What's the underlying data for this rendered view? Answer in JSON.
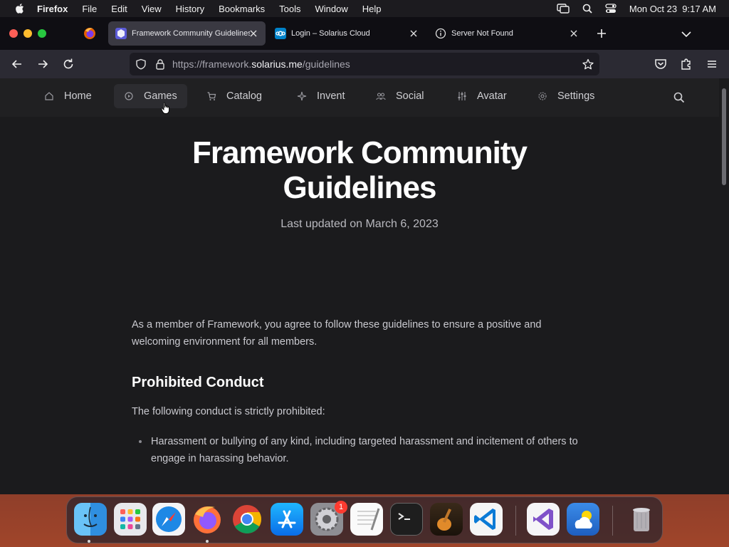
{
  "menubar": {
    "app_name": "Firefox",
    "items": [
      "File",
      "Edit",
      "View",
      "History",
      "Bookmarks",
      "Tools",
      "Window",
      "Help"
    ],
    "datetime": "Mon Oct 23  9:17 AM"
  },
  "tabs": [
    {
      "title": "Framework Community Guidelines",
      "active": true
    },
    {
      "title": "Login – Solarius Cloud",
      "active": false
    },
    {
      "title": "Server Not Found",
      "active": false
    }
  ],
  "urlbar": {
    "url_prefix": "https://framework.",
    "url_domain": "solarius.me",
    "url_path": "/guidelines"
  },
  "site_nav": {
    "items": [
      "Home",
      "Games",
      "Catalog",
      "Invent",
      "Social",
      "Avatar",
      "Settings"
    ],
    "hovered": "Games"
  },
  "page": {
    "title_line1": "Framework Community",
    "title_line2": "Guidelines",
    "updated": "Last updated on March 6, 2023",
    "intro": "As a member of Framework, you agree to follow these guidelines to ensure a positive and welcoming environment for all members.",
    "section_heading": "Prohibited Conduct",
    "section_intro": "The following conduct is strictly prohibited:",
    "bullets": [
      "Harassment or bullying of any kind, including targeted harassment and incitement of others to engage in harassing behavior."
    ]
  },
  "dock": {
    "apps": [
      "finder",
      "launchpad",
      "safari",
      "firefox",
      "chrome",
      "app-store",
      "system-settings",
      "textedit",
      "terminal",
      "garageband",
      "vscode",
      "visual-studio",
      "weather",
      "trash"
    ],
    "system_settings_badge": "1"
  },
  "colors": {
    "page_bg": "#1b1b1d",
    "nav_bg": "#202022",
    "accent_tab": "#3a3942"
  }
}
